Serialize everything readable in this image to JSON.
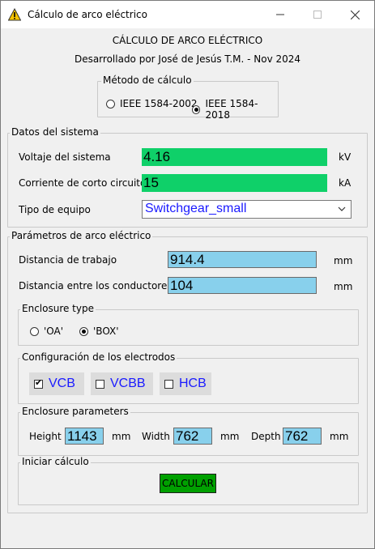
{
  "window": {
    "title": "Cálculo de arco eléctrico",
    "icon": "warning-icon"
  },
  "header": {
    "title": "CÁLCULO DE ARCO ELÉCTRICO",
    "subtitle": "Desarrollado por José de Jesús T.M. - Nov 2024"
  },
  "metodo": {
    "legend": "Método de cálculo",
    "options": [
      {
        "label": "IEEE 1584-2002",
        "selected": false
      },
      {
        "label": "IEEE 1584-2018",
        "selected": true
      }
    ]
  },
  "datos": {
    "legend": "Datos del sistema",
    "voltaje": {
      "label": "Voltaje del sistema",
      "value": "4.16",
      "unit": "kV"
    },
    "corriente": {
      "label": "Corriente de corto circuito",
      "value": "15",
      "unit": "kA"
    },
    "tipo": {
      "label": "Tipo de equipo",
      "value": "Switchgear_small"
    }
  },
  "parametros": {
    "legend": "Parámetros de arco eléctrico",
    "distancia_trabajo": {
      "label": "Distancia de trabajo",
      "value": "914.4",
      "unit": "mm"
    },
    "distancia_conductores": {
      "label": "Distancia entre los conductores",
      "value": "104",
      "unit": "mm"
    },
    "enclosure_type": {
      "legend": "Enclosure type",
      "options": [
        {
          "label": "'OA'",
          "selected": false
        },
        {
          "label": "'BOX'",
          "selected": true
        }
      ]
    },
    "electrodos": {
      "legend": "Configuración de los electrodos",
      "options": [
        {
          "label": "VCB",
          "checked": true
        },
        {
          "label": "VCBB",
          "checked": false
        },
        {
          "label": "HCB",
          "checked": false
        }
      ]
    },
    "enclosure_params": {
      "legend": "Enclosure parameters",
      "height": {
        "label": "Height",
        "value": "1143",
        "unit": "mm"
      },
      "width": {
        "label": "Width",
        "value": "762",
        "unit": "mm"
      },
      "depth": {
        "label": "Depth",
        "value": "762",
        "unit": "mm"
      }
    },
    "iniciar": {
      "legend": "Iniciar cálculo",
      "button": "CALCULAR"
    }
  },
  "colors": {
    "entry_green": "#0fd069",
    "entry_blue": "#88d0ec",
    "button_green": "#00a000",
    "link_blue": "#1a1aff"
  }
}
